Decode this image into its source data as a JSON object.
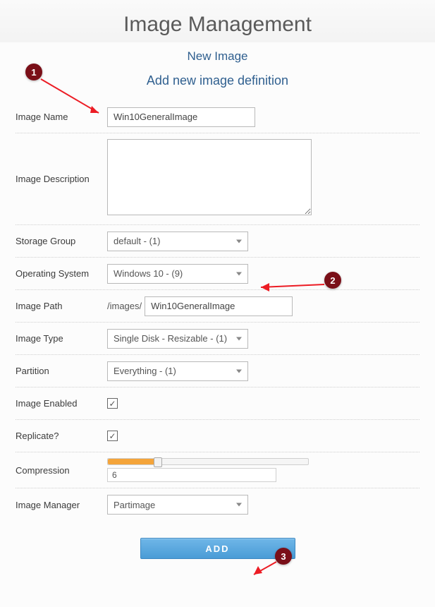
{
  "page": {
    "title": "Image Management",
    "subtitle": "New Image",
    "subheading": "Add new image definition"
  },
  "labels": {
    "image_name": "Image Name",
    "image_description": "Image Description",
    "storage_group": "Storage Group",
    "operating_system": "Operating System",
    "image_path": "Image Path",
    "image_type": "Image Type",
    "partition": "Partition",
    "image_enabled": "Image Enabled",
    "replicate": "Replicate?",
    "compression": "Compression",
    "image_manager": "Image Manager"
  },
  "fields": {
    "image_name": "Win10GeneralImage",
    "image_description": "",
    "storage_group": {
      "selected": "default - (1)"
    },
    "operating_system": {
      "selected": "Windows 10 - (9)"
    },
    "image_path": {
      "prefix": "/images/",
      "value": "Win10GeneralImage"
    },
    "image_type": {
      "selected": "Single Disk - Resizable - (1)"
    },
    "partition": {
      "selected": "Everything - (1)"
    },
    "image_enabled": true,
    "replicate": true,
    "compression": {
      "value": "6",
      "percent": 25
    },
    "image_manager": {
      "selected": "Partimage"
    }
  },
  "buttons": {
    "add": "Add"
  },
  "annotations": {
    "dot1": "1",
    "dot2": "2",
    "dot3": "3"
  }
}
